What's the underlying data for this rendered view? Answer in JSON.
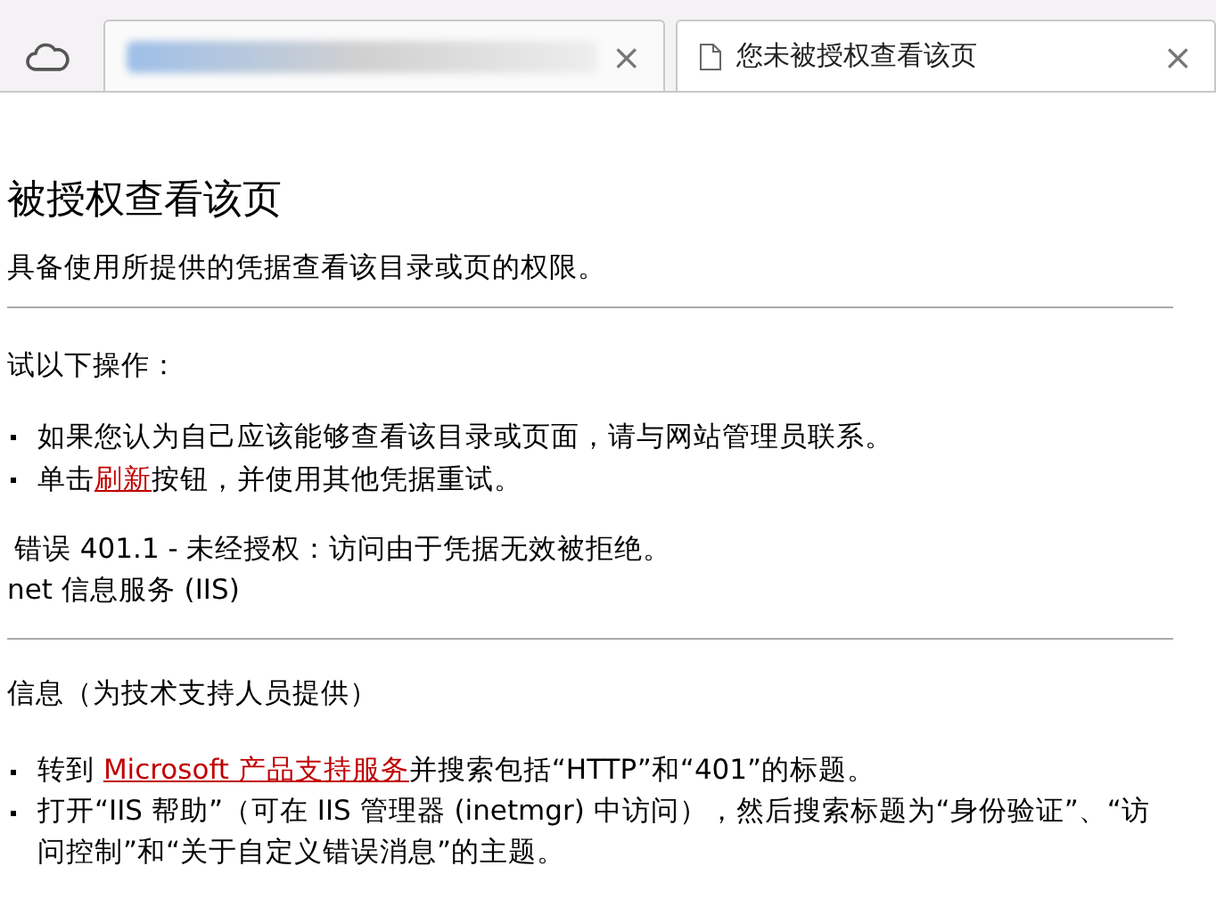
{
  "tabs": [
    {
      "kind": "blurred",
      "selected": false,
      "close": "×"
    },
    {
      "kind": "plain",
      "title": "您未被授权查看该页",
      "selected": true,
      "close": "×"
    }
  ],
  "page": {
    "heading": "被授权查看该页",
    "intro": "具备使用所提供的凭据查看该目录或页的权限。",
    "try_heading": "试以下操作：",
    "try_items": [
      {
        "before": "如果您认为自己应该能够查看该目录或页面，请与网站管理员联系。"
      },
      {
        "before": "单击",
        "link": "刷新",
        "after": "按钮，并使用其他凭据重试。"
      }
    ],
    "error_line": "错误 401.1 - 未经授权：访问由于凭据无效被拒绝。",
    "server_line": "net 信息服务 (IIS)",
    "tech_heading": "信息（为技术支持人员提供）",
    "tech_items": [
      {
        "before": "转到 ",
        "link": "Microsoft 产品支持服务",
        "after": "并搜索包括“HTTP”和“401”的标题。"
      },
      {
        "before": "打开“IIS 帮助”（可在 IIS 管理器 (inetmgr) 中访问），然后搜索标题为“身份验证”、“访问控制”和“关于自定义错误消息”的主题。"
      }
    ]
  }
}
